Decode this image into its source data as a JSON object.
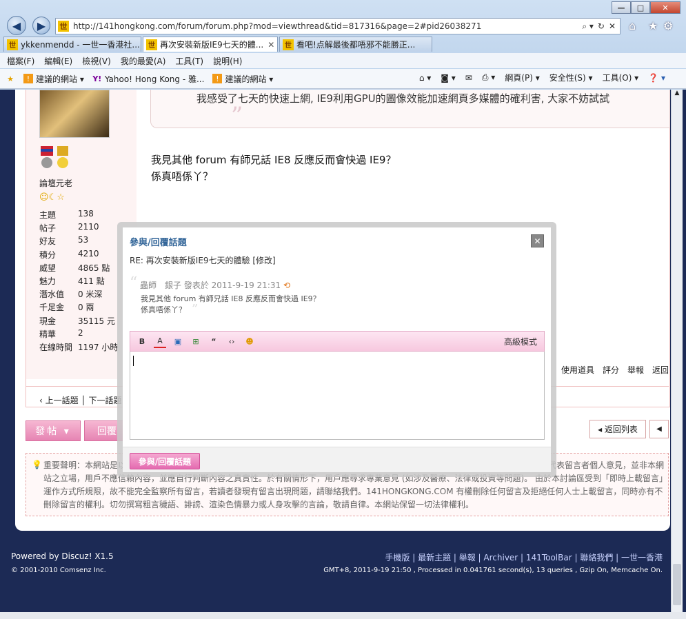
{
  "browser": {
    "url": "http://141hongkong.com/forum/forum.php?mod=viewthread&tid=817316&page=2#pid26038271",
    "tabs": [
      {
        "label": "ykkenmendd - 一世一香港社..."
      },
      {
        "label": "再次安裝新版IE9七天的體..."
      },
      {
        "label": "看吧!点解最後都唔邪不能勝正..."
      }
    ],
    "menu": [
      "檔案(F)",
      "編輯(E)",
      "檢視(V)",
      "我的最愛(A)",
      "工具(T)",
      "說明(H)"
    ],
    "favorites": [
      "建議的網站 ▾",
      "Yahoo! Hong Kong - 雅...",
      "建議的網站 ▾"
    ],
    "commands": [
      "網頁(P) ▾",
      "安全性(S) ▾",
      "工具(O) ▾"
    ]
  },
  "profile": {
    "title": "論壇元老",
    "stats": [
      {
        "label": "主題",
        "value": "138"
      },
      {
        "label": "帖子",
        "value": "2110"
      },
      {
        "label": "好友",
        "value": "53"
      },
      {
        "label": "積分",
        "value": "4210"
      },
      {
        "label": "威望",
        "value": "4865 點"
      },
      {
        "label": "魅力",
        "value": "411 點"
      },
      {
        "label": "潛水值",
        "value": "0 米深"
      },
      {
        "label": "千足金",
        "value": "0 兩"
      },
      {
        "label": "現金",
        "value": "35115 元"
      },
      {
        "label": "精華",
        "value": "2"
      },
      {
        "label": "在線時間",
        "value": "1197 小時"
      }
    ]
  },
  "post": {
    "quote_text": "我感受了七天的快速上網, IE9利用GPU的圖像效能加速網頁多媒體的確利害, 大家不妨試試",
    "message_line1": "我見其他 forum 有師兄話 IE8 反應反而會快過 IE9？",
    "message_line2": "係真唔係丫？",
    "actions": [
      "使用道具",
      "評分",
      "舉報",
      "返回"
    ],
    "nav": "‹ 上一話題 │ 下一話題 ›"
  },
  "buttons": {
    "post": "發帖 ▾",
    "reply": "回覆",
    "back_list": "◂ 返回列表"
  },
  "notice": "重要聲明：本網站是以即時上載留言的方式運作，本網站對所有留言的真實性、完整性及立場等，不負任何法律責任。而一切留言之言論只代表留言者個人意見，並非本網站之立場，用戶不應信賴內容，並應自行判斷內容之真實性。於有關情形下，用戶應尋求專業意見 (如涉及醫療、法律或投資等問題)。 由於本討論區受到「即時上載留言」運作方式所規限，故不能完全監察所有留言，若讀者發現有留言出現問題，請聯絡我們。141HONGKONG.COM 有權刪除任何留言及拒絕任何人士上載留言，同時亦有不刪除留言的權利。切勿撰寫粗言穢語、誹謗、渲染色情暴力或人身攻擊的言論，敬請自律。本網站保留一切法律權利。",
  "footer": {
    "powered": "Powered by Discuz! X1.5",
    "copyright": "© 2001-2010 Comsenz Inc.",
    "links": "手機版 | 最新主題 | 舉報 | Archiver | 141ToolBar | 聯絡我們 | 一世一香港",
    "stats": "GMT+8, 2011-9-19 21:50 , Processed in 0.041761 second(s), 13 queries , Gzip On, Memcache On."
  },
  "modal": {
    "title": "參與/回覆話題",
    "subject": "RE: 再次安裝新版IE9七天的體驗 [修改]",
    "quote_author": "蟲師　銀子 發表於 2011-9-19 21:31",
    "quote_line1": "我見其他 forum 有師兄話 IE8 反應反而會快過 IE9？",
    "quote_line2": "係真唔係丫？",
    "advanced_mode": "高級模式",
    "submit": "參與/回覆話題"
  },
  "colors": {
    "accent": "#336699",
    "pink": "#e684b3",
    "footer_bg": "#1c2a55"
  }
}
